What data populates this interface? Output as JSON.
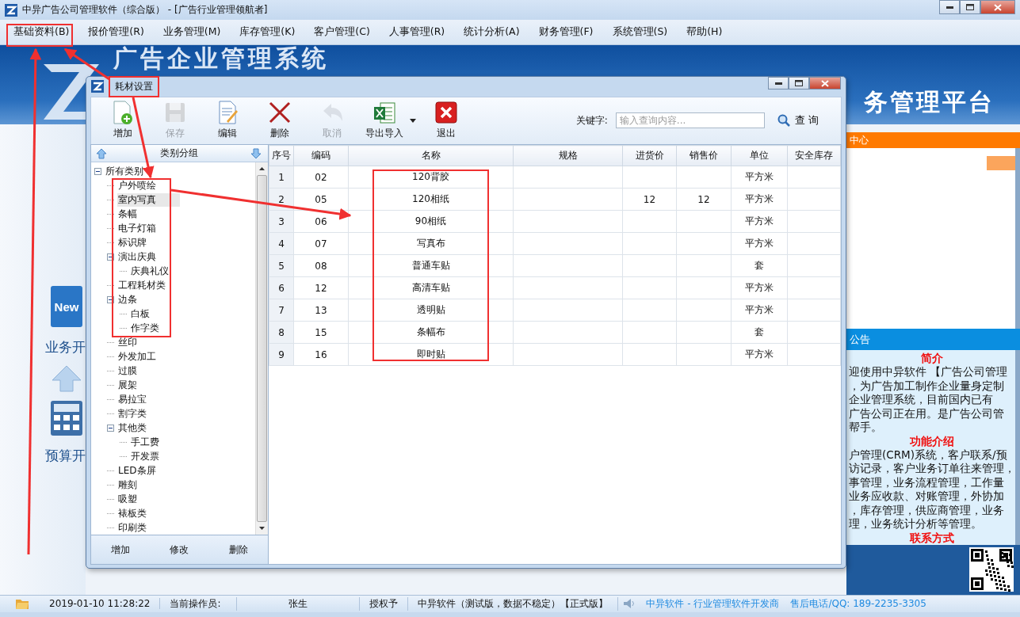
{
  "window": {
    "title": "中异广告公司管理软件（综合版） - [广告行业管理领航者]"
  },
  "menu": [
    {
      "label": "基础资料(B)"
    },
    {
      "label": "报价管理(R)"
    },
    {
      "label": "业务管理(M)"
    },
    {
      "label": "库存管理(K)"
    },
    {
      "label": "客户管理(C)"
    },
    {
      "label": "人事管理(R)"
    },
    {
      "label": "统计分析(A)"
    },
    {
      "label": "财务管理(F)"
    },
    {
      "label": "系统管理(S)"
    },
    {
      "label": "帮助(H)"
    }
  ],
  "banner": {
    "title": "广告企业管理系统",
    "subtitle": "务管理平台"
  },
  "launcher": [
    {
      "label": "业务开",
      "kind": "new",
      "icon_text": "New"
    },
    {
      "label": "预算开",
      "kind": "calc"
    }
  ],
  "right_panel": {
    "header": "中心",
    "notice_header": "公告",
    "sections": [
      {
        "heading": "简介",
        "lines": [
          "迎使用中异软件 【广告公司管理",
          "，为广告加工制作企业量身定制",
          "企业管理系统，目前国内已有",
          "广告公司正在用。是广告公司管",
          "帮手。"
        ]
      },
      {
        "heading": "功能介绍",
        "lines": [
          "户管理(CRM)系统，客户联系/预",
          "访记录，客户业务订单往来管理，",
          "事管理，业务流程管理，工作量",
          "业务应收款、对账管理，外协加",
          "，库存管理，供应商管理，业务",
          "理，业务统计分析等管理。"
        ]
      },
      {
        "heading": "联系方式"
      }
    ]
  },
  "dialog": {
    "title": "耗材设置",
    "toolbar": [
      {
        "label": "增加",
        "kind": "add",
        "disabled": false
      },
      {
        "label": "保存",
        "kind": "save",
        "disabled": true
      },
      {
        "label": "编辑",
        "kind": "edit",
        "disabled": false
      },
      {
        "label": "删除",
        "kind": "delete",
        "disabled": false
      },
      {
        "label": "取消",
        "kind": "undo",
        "disabled": true
      },
      {
        "label": "导出导入",
        "kind": "excel",
        "disabled": false,
        "dropdown": true
      },
      {
        "label": "退出",
        "kind": "exit",
        "disabled": false
      }
    ],
    "keyword_label": "关键字:",
    "search": {
      "placeholder": "输入查询内容..."
    },
    "search_button": "查 询",
    "category_panel": {
      "title": "类别分组",
      "buttons": [
        "增加",
        "修改",
        "删除"
      ],
      "tree": [
        {
          "label": "所有类别",
          "expanded": true,
          "selected": false,
          "children": [
            {
              "label": "户外喷绘",
              "selected": false
            },
            {
              "label": "室内写真",
              "selected": true
            },
            {
              "label": "条幅",
              "selected": false
            },
            {
              "label": "电子灯箱",
              "selected": false
            },
            {
              "label": "标识牌",
              "selected": false
            },
            {
              "label": "演出庆典",
              "expanded": true,
              "selected": false,
              "children": [
                {
                  "label": "庆典礼仪",
                  "selected": false
                }
              ]
            },
            {
              "label": "工程耗材类",
              "selected": false
            },
            {
              "label": "边条",
              "expanded": true,
              "selected": false,
              "children": [
                {
                  "label": "白板",
                  "selected": false
                },
                {
                  "label": "作字类",
                  "selected": false
                }
              ]
            },
            {
              "label": "丝印",
              "selected": false
            },
            {
              "label": "外发加工",
              "selected": false
            },
            {
              "label": "过膜",
              "selected": false
            },
            {
              "label": "展架",
              "selected": false
            },
            {
              "label": "易拉宝",
              "selected": false
            },
            {
              "label": "割字类",
              "selected": false
            },
            {
              "label": "其他类",
              "expanded": true,
              "selected": false,
              "children": [
                {
                  "label": "手工费",
                  "selected": false
                },
                {
                  "label": "开发票",
                  "selected": false
                }
              ]
            },
            {
              "label": "LED条屏",
              "selected": false
            },
            {
              "label": "雕刻",
              "selected": false
            },
            {
              "label": "吸塑",
              "selected": false
            },
            {
              "label": "裱板类",
              "selected": false
            },
            {
              "label": "印刷类",
              "selected": false
            }
          ]
        }
      ]
    },
    "table": {
      "columns": [
        "序号",
        "编码",
        "名称",
        "规格",
        "进货价",
        "销售价",
        "单位",
        "安全库存"
      ],
      "rows": [
        {
          "no": "1",
          "code": "02",
          "name": "120背胶",
          "unit": "平方米"
        },
        {
          "no": "2",
          "code": "05",
          "name": "120相纸",
          "purchase_price": "12",
          "sale_price": "12",
          "unit": "平方米"
        },
        {
          "no": "3",
          "code": "06",
          "name": "90相纸",
          "unit": "平方米"
        },
        {
          "no": "4",
          "code": "07",
          "name": "写真布",
          "unit": "平方米"
        },
        {
          "no": "5",
          "code": "08",
          "name": "普通车贴",
          "unit": "套"
        },
        {
          "no": "6",
          "code": "12",
          "name": "高清车贴",
          "unit": "平方米"
        },
        {
          "no": "7",
          "code": "13",
          "name": "透明贴",
          "unit": "平方米"
        },
        {
          "no": "8",
          "code": "15",
          "name": "条幅布",
          "unit": "套"
        },
        {
          "no": "9",
          "code": "16",
          "name": "即时贴",
          "unit": "平方米"
        }
      ]
    }
  },
  "status_bar": {
    "datetime": "2019-01-10 11:28:22",
    "operator_label": "当前操作员:",
    "operator": "张生",
    "license_label": "授权予",
    "license": "中异软件（测试版，数据不稳定）【正式版】",
    "company": "中异软件 - 行业管理软件开发商",
    "hotline": "售后电话/QQ: 189-2235-3305"
  }
}
